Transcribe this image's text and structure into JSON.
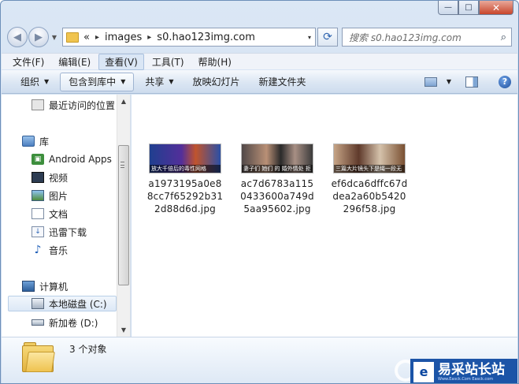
{
  "window": {
    "caption_buttons": {
      "minimize": "—",
      "maximize": "□",
      "close": "✕"
    }
  },
  "address": {
    "overflow": "«",
    "crumbs": [
      "images",
      "s0.hao123img.com"
    ],
    "separator": "▸",
    "dropdown": "▾"
  },
  "search": {
    "placeholder": "搜索 s0.hao123img.com"
  },
  "menu": {
    "items": [
      "文件(F)",
      "编辑(E)",
      "查看(V)",
      "工具(T)",
      "帮助(H)"
    ],
    "active_index": 2
  },
  "toolbar": {
    "organize": "组织",
    "include_library": "包含到库中",
    "share": "共享",
    "slideshow": "放映幻灯片",
    "new_folder": "新建文件夹",
    "dropdown": "▼",
    "help": "?"
  },
  "nav": {
    "recent": "最近访问的位置",
    "library": "库",
    "android_apps": "Android Apps",
    "videos": "视频",
    "pictures": "图片",
    "documents": "文档",
    "thunder": "迅雷下载",
    "music": "音乐",
    "computer": "计算机",
    "local_disk": "本地磁盘 (C:)",
    "new_volume": "新加卷 (D:)"
  },
  "scrollbar": {
    "up": "▲",
    "down": "▼"
  },
  "files": [
    {
      "name": "a1973195a0e88cc7f65292b312d88d6d.jpg",
      "caption": "放大千倍后的毒性网格"
    },
    {
      "name": "ac7d6783a1150433600a749d5aa95602.jpg",
      "caption": "妻子们 她们 的 婚外情处 拒 绝"
    },
    {
      "name": "ef6dca6dffc67ddea2a60b5420296f58.jpg",
      "caption": "三篇大片镜头下是绳一段无"
    }
  ],
  "status": {
    "count": "3 个对象"
  },
  "watermark": {
    "brand": "易采站长站",
    "subtitle": "Www.Easck.Com  Easck.com"
  },
  "colors": {
    "accent": "#0a46a0",
    "folder": "#f0c44f"
  }
}
